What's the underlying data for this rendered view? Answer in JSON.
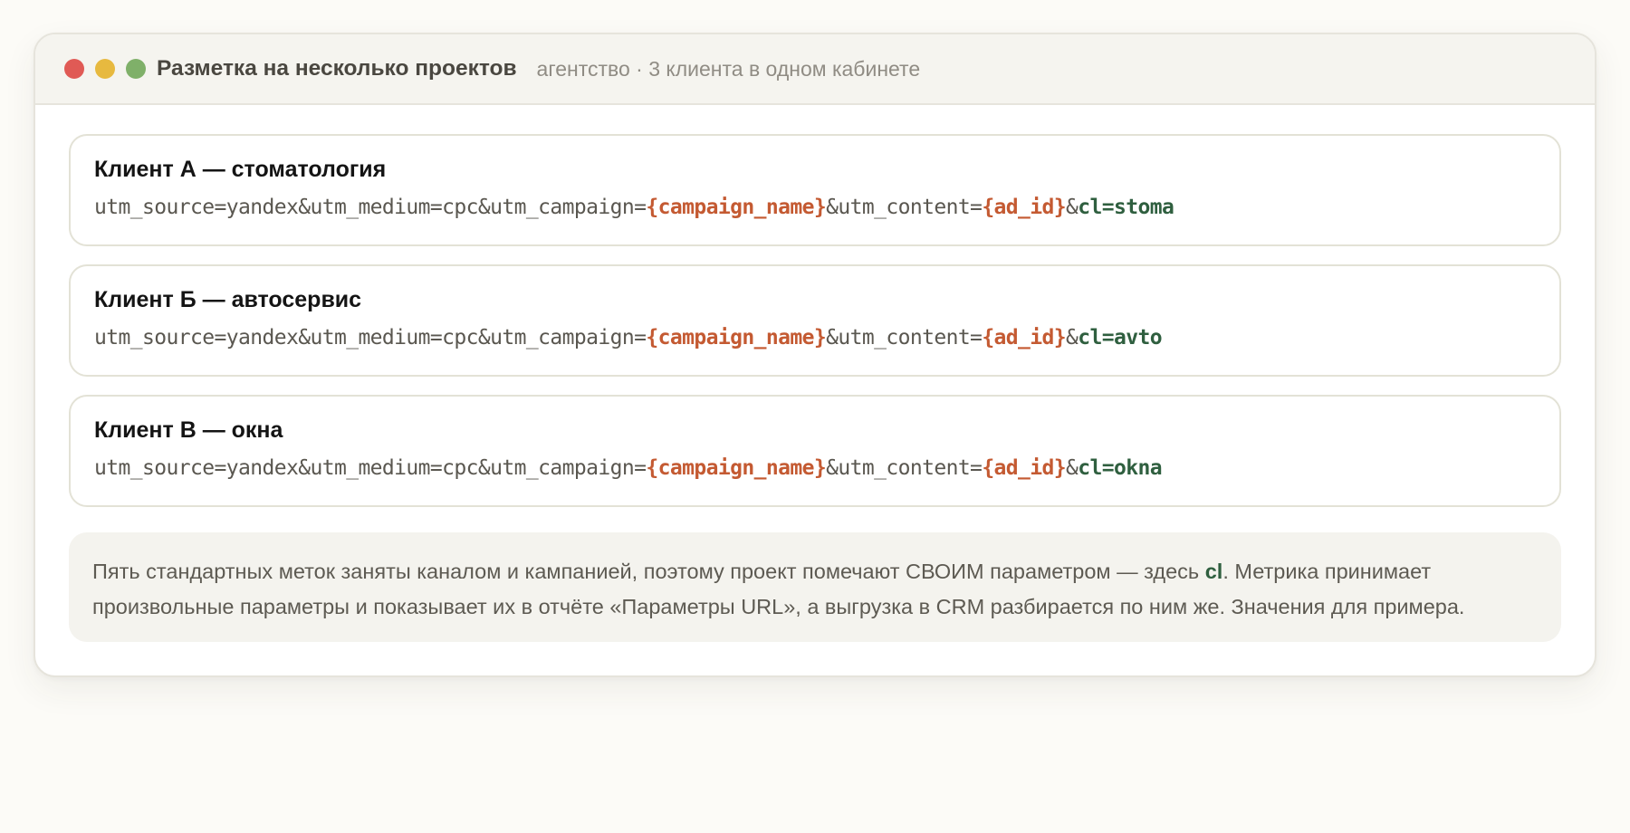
{
  "window": {
    "title": "Разметка на несколько проектов",
    "subtitle": "агентство · 3 клиента в одном кабинете"
  },
  "clients": [
    {
      "title": "Клиент А — стоматология",
      "url": {
        "prefix": "utm_source=yandex&utm_medium=cpc&utm_campaign=",
        "campaign_placeholder": "{campaign_name}",
        "content_key": "&utm_content=",
        "ad_placeholder": "{ad_id}",
        "amp": "&",
        "cl_param": "cl=stoma"
      }
    },
    {
      "title": "Клиент Б — автосервис",
      "url": {
        "prefix": "utm_source=yandex&utm_medium=cpc&utm_campaign=",
        "campaign_placeholder": "{campaign_name}",
        "content_key": "&utm_content=",
        "ad_placeholder": "{ad_id}",
        "amp": "&",
        "cl_param": "cl=avto"
      }
    },
    {
      "title": "Клиент В — окна",
      "url": {
        "prefix": "utm_source=yandex&utm_medium=cpc&utm_campaign=",
        "campaign_placeholder": "{campaign_name}",
        "content_key": "&utm_content=",
        "ad_placeholder": "{ad_id}",
        "amp": "&",
        "cl_param": "cl=okna"
      }
    }
  ],
  "note": {
    "before": "Пять стандартных меток заняты каналом и кампанией, поэтому проект помечают СВОИМ параметром — здесь ",
    "highlight": "cl",
    "after": ". Метрика принимает произвольные параметры и показывает их в отчёте «Параметры URL», а выгрузка в CRM разбирается по ним же. Значения для примера."
  },
  "colors": {
    "placeholder": "#c45a32",
    "param": "#2f5f3f",
    "close_dot": "#e05a55",
    "minimize_dot": "#e7b93f",
    "zoom_dot": "#7fb069"
  }
}
